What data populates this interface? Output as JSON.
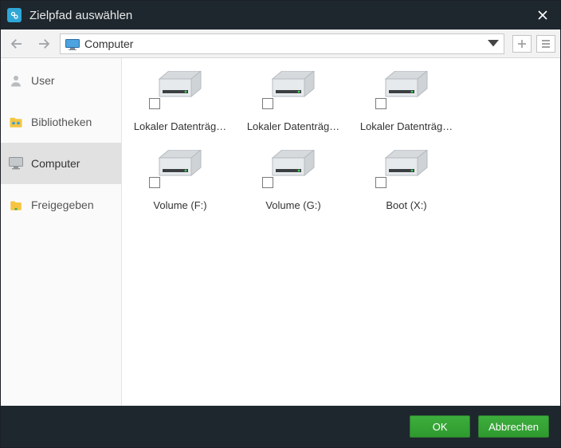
{
  "window": {
    "title": "Zielpfad auswählen"
  },
  "address": {
    "label": "Computer"
  },
  "sidebar": {
    "items": [
      {
        "label": "User"
      },
      {
        "label": "Bibliotheken"
      },
      {
        "label": "Computer"
      },
      {
        "label": "Freigegeben"
      }
    ],
    "active_index": 2
  },
  "drives": [
    {
      "label": "Lokaler Datenträg…",
      "checked": false
    },
    {
      "label": "Lokaler Datenträg…",
      "checked": false
    },
    {
      "label": "Lokaler Datenträg…",
      "checked": false
    },
    {
      "label": "Volume (F:)",
      "checked": false
    },
    {
      "label": "Volume (G:)",
      "checked": false
    },
    {
      "label": "Boot (X:)",
      "checked": false
    }
  ],
  "footer": {
    "ok": "OK",
    "cancel": "Abbrechen"
  }
}
